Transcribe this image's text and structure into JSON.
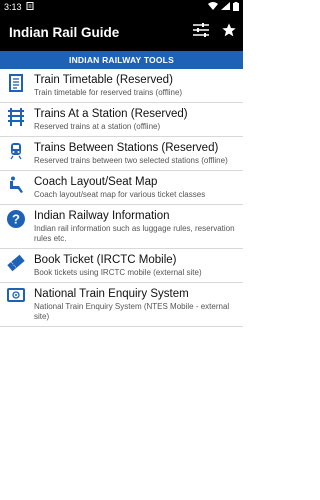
{
  "status_bar": {
    "time": "3:13"
  },
  "app_bar": {
    "title": "Indian Rail Guide"
  },
  "section_header": "INDIAN RAILWAY TOOLS",
  "items": [
    {
      "title": "Train Timetable (Reserved)",
      "desc": "Train timetable for reserved trains (offline)",
      "icon": "document-icon"
    },
    {
      "title": "Trains At a Station (Reserved)",
      "desc": "Reserved trains at a station (offline)",
      "icon": "railway-track-icon"
    },
    {
      "title": "Trains Between Stations (Reserved)",
      "desc": "Reserved trains between two selected stations (offline)",
      "icon": "train-icon"
    },
    {
      "title": "Coach Layout/Seat Map",
      "desc": "Coach layout/seat map for various ticket classes",
      "icon": "seat-icon"
    },
    {
      "title": "Indian Railway Information",
      "desc": "Indian rail information such as luggage rules, reservation rules etc.",
      "icon": "help-icon"
    },
    {
      "title": "Book Ticket (IRCTC Mobile)",
      "desc": "Book tickets using IRCTC mobile (external site)",
      "icon": "ticket-icon"
    },
    {
      "title": "National Train Enquiry System",
      "desc": "National Train Enquiry System (NTES Mobile - external site)",
      "icon": "ntes-icon"
    }
  ],
  "colors": {
    "app_bar": "#000000",
    "accent": "#1e62b8",
    "icon": "#1e62b8"
  }
}
